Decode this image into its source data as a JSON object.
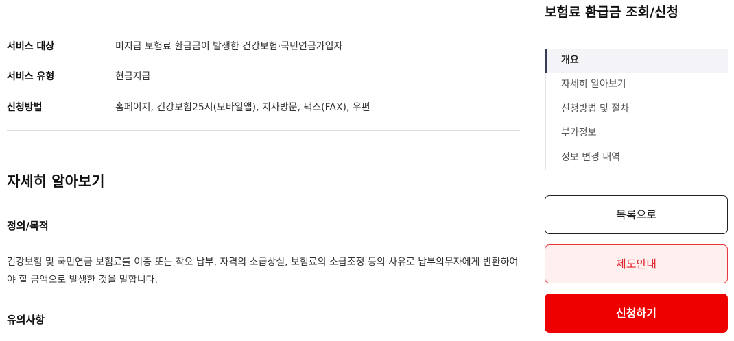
{
  "summary": {
    "rows": [
      {
        "key": "서비스 대상",
        "value": "미지급 보험료 환급금이 발생한 건강보험·국민연금가입자"
      },
      {
        "key": "서비스 유형",
        "value": "현금지급"
      },
      {
        "key": "신청방법",
        "value": "홈페이지, 건강보험25시(모바일앱), 지사방문, 팩스(FAX), 우편"
      }
    ]
  },
  "detail": {
    "title": "자세히 알아보기",
    "purpose_title": "정의/목적",
    "purpose_text": "건강보험 및 국민연금 보험료를 이중 또는 착오 납부, 자격의 소급상실, 보험료의 소급조정 등의 사유로 납부의무자에게 반환하여야 할 금액으로 발생한 것을 말합니다.",
    "notice_title": "유의사항"
  },
  "sidebar": {
    "title": "보험료 환급금 조회/신청",
    "toc": [
      {
        "label": "개요",
        "active": true
      },
      {
        "label": "자세히 알아보기",
        "active": false
      },
      {
        "label": "신청방법 및 절차",
        "active": false
      },
      {
        "label": "부가정보",
        "active": false
      },
      {
        "label": "정보 변경 내역",
        "active": false
      }
    ],
    "buttons": {
      "list": "목록으로",
      "guide": "제도안내",
      "apply": "신청하기"
    }
  },
  "colors": {
    "accent_red": "#ee0000",
    "toc_active_bar": "#3a3d55"
  }
}
